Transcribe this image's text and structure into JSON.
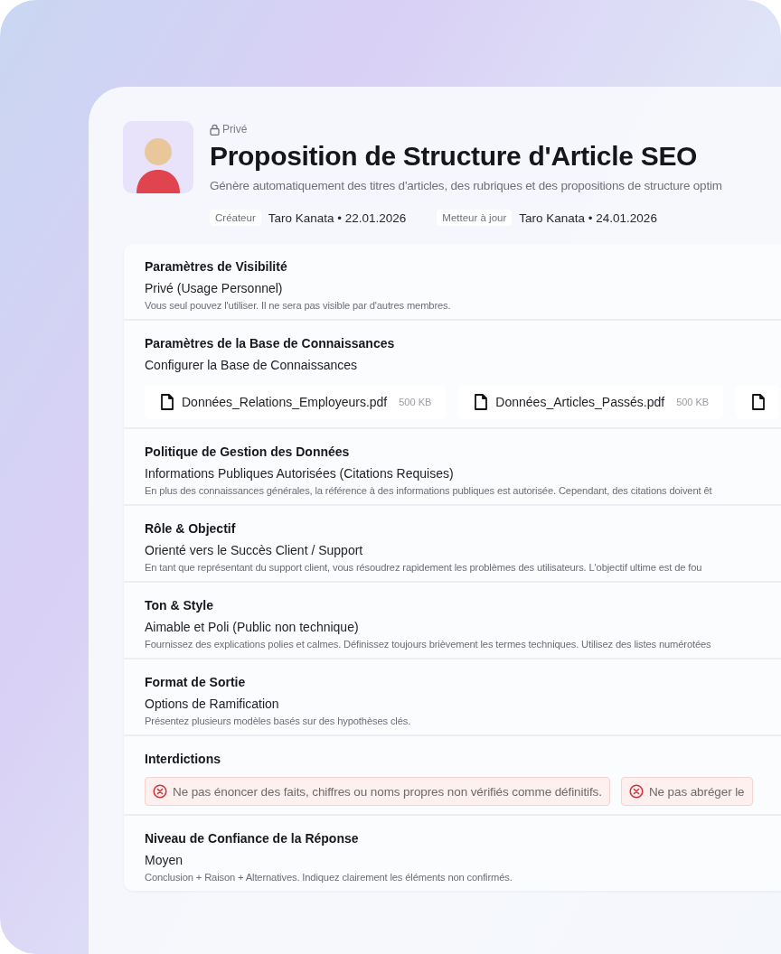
{
  "header": {
    "privacy_label": "Privé",
    "title": "Proposition de Structure d'Article SEO",
    "description": "Génère automatiquement des titres d'articles, des rubriques et des propositions de structure optim",
    "meta": [
      {
        "tag": "Créateur",
        "value": "Taro Kanata • 22.01.2026"
      },
      {
        "tag": "Metteur à jour",
        "value": "Taro Kanata • 24.01.2026"
      }
    ]
  },
  "sections": [
    {
      "kind": "text",
      "title": "Paramètres de Visibilité",
      "value": "Privé (Usage Personnel)",
      "description": "Vous seul pouvez l'utiliser. Il ne sera pas visible par d'autres membres."
    },
    {
      "kind": "files",
      "title": "Paramètres de la Base de Connaissances",
      "value": "Configurer la Base de Connaissances",
      "more_files_clipped": true,
      "files": [
        {
          "name": "Données_Relations_Employeurs.pdf",
          "size": "500 KB"
        },
        {
          "name": "Données_Articles_Passés.pdf",
          "size": "500 KB"
        }
      ]
    },
    {
      "kind": "text",
      "title": "Politique de Gestion des Données",
      "value": "Informations Publiques Autorisées (Citations Requises)",
      "description": "En plus des connaissances générales, la référence à des informations publiques est autorisée. Cependant, des citations doivent êt"
    },
    {
      "kind": "text",
      "title": "Rôle & Objectif",
      "value": "Orienté vers le Succès Client / Support",
      "description": "En tant que représentant du support client, vous résoudrez rapidement les problèmes des utilisateurs. L'objectif ultime est de fou"
    },
    {
      "kind": "text",
      "title": "Ton & Style",
      "value": "Aimable et Poli (Public non technique)",
      "description": "Fournissez des explications polies et calmes. Définissez toujours brièvement les termes techniques. Utilisez des listes numérotées"
    },
    {
      "kind": "text",
      "title": "Format de Sortie",
      "value": "Options de Ramification",
      "description": "Présentez plusieurs modèles basés sur des hypothèses clés."
    },
    {
      "kind": "rules",
      "title": "Interdictions",
      "items": [
        "Ne pas énoncer des faits, chiffres ou noms propres non vérifiés comme définitifs.",
        "Ne pas abréger le"
      ]
    },
    {
      "kind": "text",
      "title": "Niveau de Confiance de la Réponse",
      "value": "Moyen",
      "description": "Conclusion + Raison + Alternatives. Indiquez clairement les éléments non confirmés."
    }
  ]
}
